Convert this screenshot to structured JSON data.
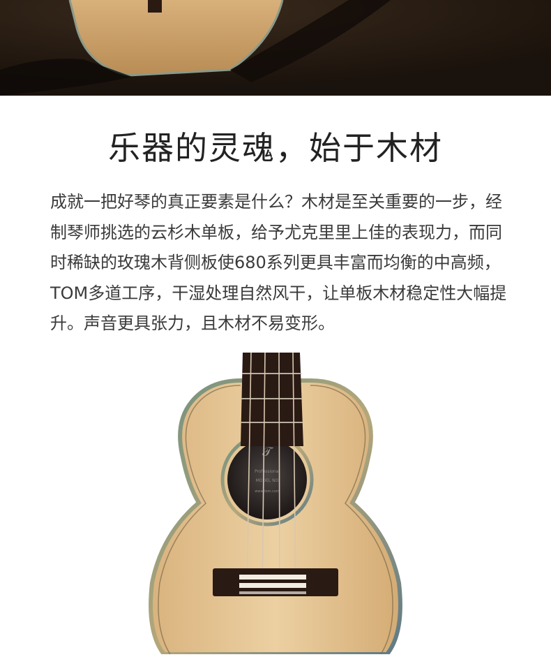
{
  "hero": {
    "description_icon": "guitar-photo"
  },
  "section": {
    "title": "乐器的灵魂，始于木材",
    "lines": [
      "成就一把好琴的真正要素是什么？木材是至关重要的一步，经",
      "制琴师挑选的云杉木单板，给予尤克里里上佳的表现力，而同",
      "时稀缺的玫瑰木背侧板使680系列更具丰富而均衡的中高频，",
      "TOM多道工序，干湿处理自然风干，让单板木材稳定性大幅提",
      "升。声音更具张力，且木材不易变形。"
    ]
  },
  "ukulele": {
    "label_lines": [
      "Professional",
      "MODEL NO",
      "www.tom.com"
    ],
    "colors": {
      "top": "#e3c08d",
      "binding": "#6b5a3c",
      "fretboard": "#2a1a14",
      "soundhole": "#1a1412"
    }
  }
}
